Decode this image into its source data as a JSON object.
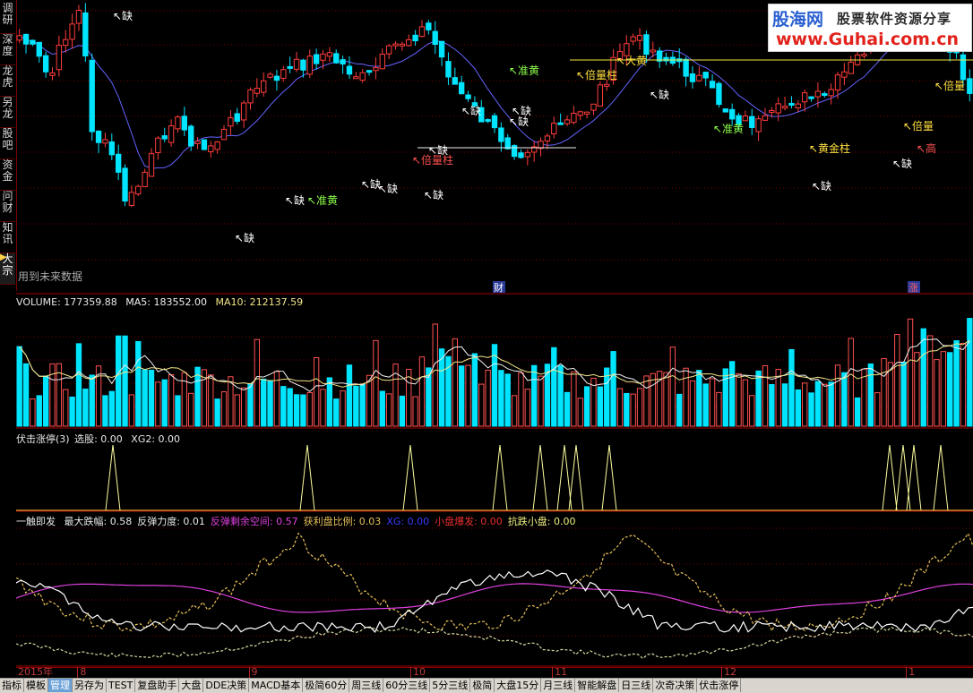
{
  "sidebar": {
    "tabs": [
      "调研",
      "深度",
      "龙虎",
      "另龙",
      "股吧",
      "资金",
      "问财",
      "知讯",
      "大宗"
    ],
    "active_index": 8
  },
  "main_chart": {
    "future_note": "用到未来数据",
    "event_labels": [
      "财",
      "涨"
    ],
    "signals": {
      "que": "缺",
      "zhun_huang": "准黄",
      "bei_liang": "倍量",
      "bei_liang_zhu": "倍量柱",
      "da_huang": "大黄",
      "huang_jin_zhu": "黄金柱",
      "gao": "高"
    }
  },
  "volume_panel": {
    "label": "VOLUME: 177359.88",
    "ma5": "MA5: 183552.00",
    "ma10": "MA10: 212137.59"
  },
  "signal_panel": {
    "name": "伏击涨停(3)",
    "pick": "选股: 0.00",
    "xg2": "XG2: 0.00"
  },
  "indicator_panel": {
    "name": "一触即发",
    "fields": [
      {
        "text": "最大跌幅: 0.58",
        "color": "#e8e8e8"
      },
      {
        "text": "反弹力度: 0.01",
        "color": "#e8e8e8"
      },
      {
        "text": "反弹剩余空间: 0.57",
        "color": "#e040e0"
      },
      {
        "text": "获利盘比例: 0.03",
        "color": "#e8c05a"
      },
      {
        "text": "XG: 0.00",
        "color": "#3a3aff"
      },
      {
        "text": "小盘爆发: 0.00",
        "color": "#e83030"
      },
      {
        "text": "抗跌小盘: 0.00",
        "color": "#f0f080"
      }
    ]
  },
  "date_axis": {
    "labels": [
      {
        "text": "2015年",
        "pos": 0.0
      },
      {
        "text": "8",
        "pos": 0.064
      },
      {
        "text": "9",
        "pos": 0.243
      },
      {
        "text": "10",
        "pos": 0.412
      },
      {
        "text": "11",
        "pos": 0.56
      },
      {
        "text": "12",
        "pos": 0.737
      },
      {
        "text": "1",
        "pos": 0.93
      }
    ]
  },
  "watermark": {
    "logo": "股海网",
    "slogan": "股票软件资源分享",
    "url": "www.Guhai.com.cn"
  },
  "tabbar": {
    "tabs": [
      "指标",
      "模板",
      "管理",
      "另存为",
      "TEST",
      "复盘助手",
      "大盘",
      "DDE决策",
      "MACD基本",
      "极简60分",
      "周三线",
      "60分三线",
      "5分三线",
      "极简",
      "大盘15分",
      "月三线",
      "智能解盘",
      "日三线",
      "次奇决策",
      "伏击涨停"
    ],
    "active_index": 2
  },
  "colors": {
    "up": "#ff3c3c",
    "down": "#00e5ff",
    "ma": "#6464ff",
    "grid": "#7a0000",
    "signal": "#ffffa0"
  }
}
